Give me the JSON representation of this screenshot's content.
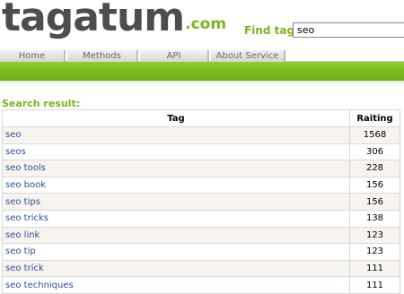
{
  "logo": {
    "main": "tagatum",
    "suffix": ".com"
  },
  "search": {
    "label": "Find tags",
    "value": "seo"
  },
  "nav": {
    "tabs": [
      {
        "label": "Home"
      },
      {
        "label": "Methods"
      },
      {
        "label": "API"
      },
      {
        "label": "About Service"
      }
    ]
  },
  "results": {
    "title": "Search result:",
    "columns": {
      "tag": "Tag",
      "rating": "Raiting"
    },
    "rows": [
      {
        "tag": "seo",
        "count": "1568"
      },
      {
        "tag": "seos",
        "count": "306"
      },
      {
        "tag": "seo tools",
        "count": "228"
      },
      {
        "tag": "seo book",
        "count": "156"
      },
      {
        "tag": "seo tips",
        "count": "156"
      },
      {
        "tag": "seo tricks",
        "count": "138"
      },
      {
        "tag": "seo link",
        "count": "123"
      },
      {
        "tag": "seo tip",
        "count": "123"
      },
      {
        "tag": "seo trick",
        "count": "111"
      },
      {
        "tag": "seo techniques",
        "count": "111"
      }
    ]
  },
  "colors": {
    "brand_green": "#7ab51d",
    "link_blue": "#2a4f9f",
    "logo_grey": "#4d4d4d"
  }
}
